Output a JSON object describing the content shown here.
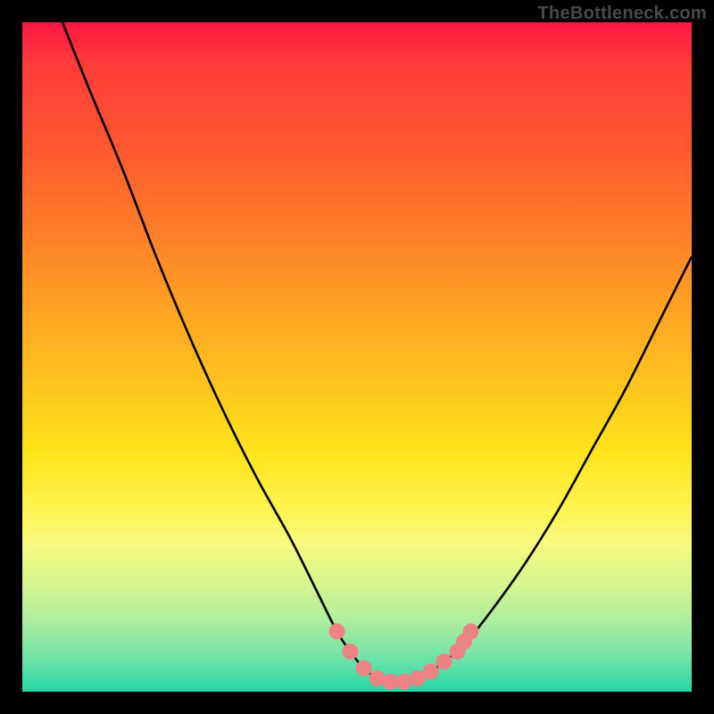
{
  "watermark": "TheBottleneck.com",
  "colors": {
    "frame": "#000000",
    "curve": "#000000",
    "markers": "#ee8383",
    "gradient_stops": [
      "#ff1744",
      "#ff5630",
      "#ffa024",
      "#ffe31a",
      "#f6f97e",
      "#a8eda0",
      "#26d7a5"
    ]
  },
  "chart_data": {
    "type": "line",
    "title": "",
    "xlabel": "",
    "ylabel": "",
    "xlim": [
      0,
      100
    ],
    "ylim": [
      0,
      100
    ],
    "grid": false,
    "legend": false,
    "series": [
      {
        "name": "bottleneck-curve",
        "x": [
          6,
          10,
          15,
          20,
          25,
          30,
          35,
          40,
          44,
          47,
          49,
          51,
          53,
          55,
          57,
          59,
          61,
          63,
          66,
          70,
          75,
          80,
          85,
          90,
          95,
          100
        ],
        "values": [
          100,
          90,
          78,
          65,
          53,
          42,
          32,
          23,
          15,
          9,
          6,
          3.5,
          2,
          1.5,
          1.5,
          2,
          3,
          4.5,
          7,
          12,
          19,
          27,
          36,
          45,
          55,
          65
        ]
      }
    ],
    "markers": [
      {
        "x": 47,
        "y": 9
      },
      {
        "x": 49,
        "y": 6
      },
      {
        "x": 51,
        "y": 3.5
      },
      {
        "x": 53,
        "y": 2
      },
      {
        "x": 55,
        "y": 1.5
      },
      {
        "x": 57,
        "y": 1.5
      },
      {
        "x": 59,
        "y": 2
      },
      {
        "x": 61,
        "y": 3
      },
      {
        "x": 63,
        "y": 4.5
      },
      {
        "x": 65,
        "y": 6
      },
      {
        "x": 66,
        "y": 7.5
      },
      {
        "x": 67,
        "y": 9
      }
    ]
  }
}
